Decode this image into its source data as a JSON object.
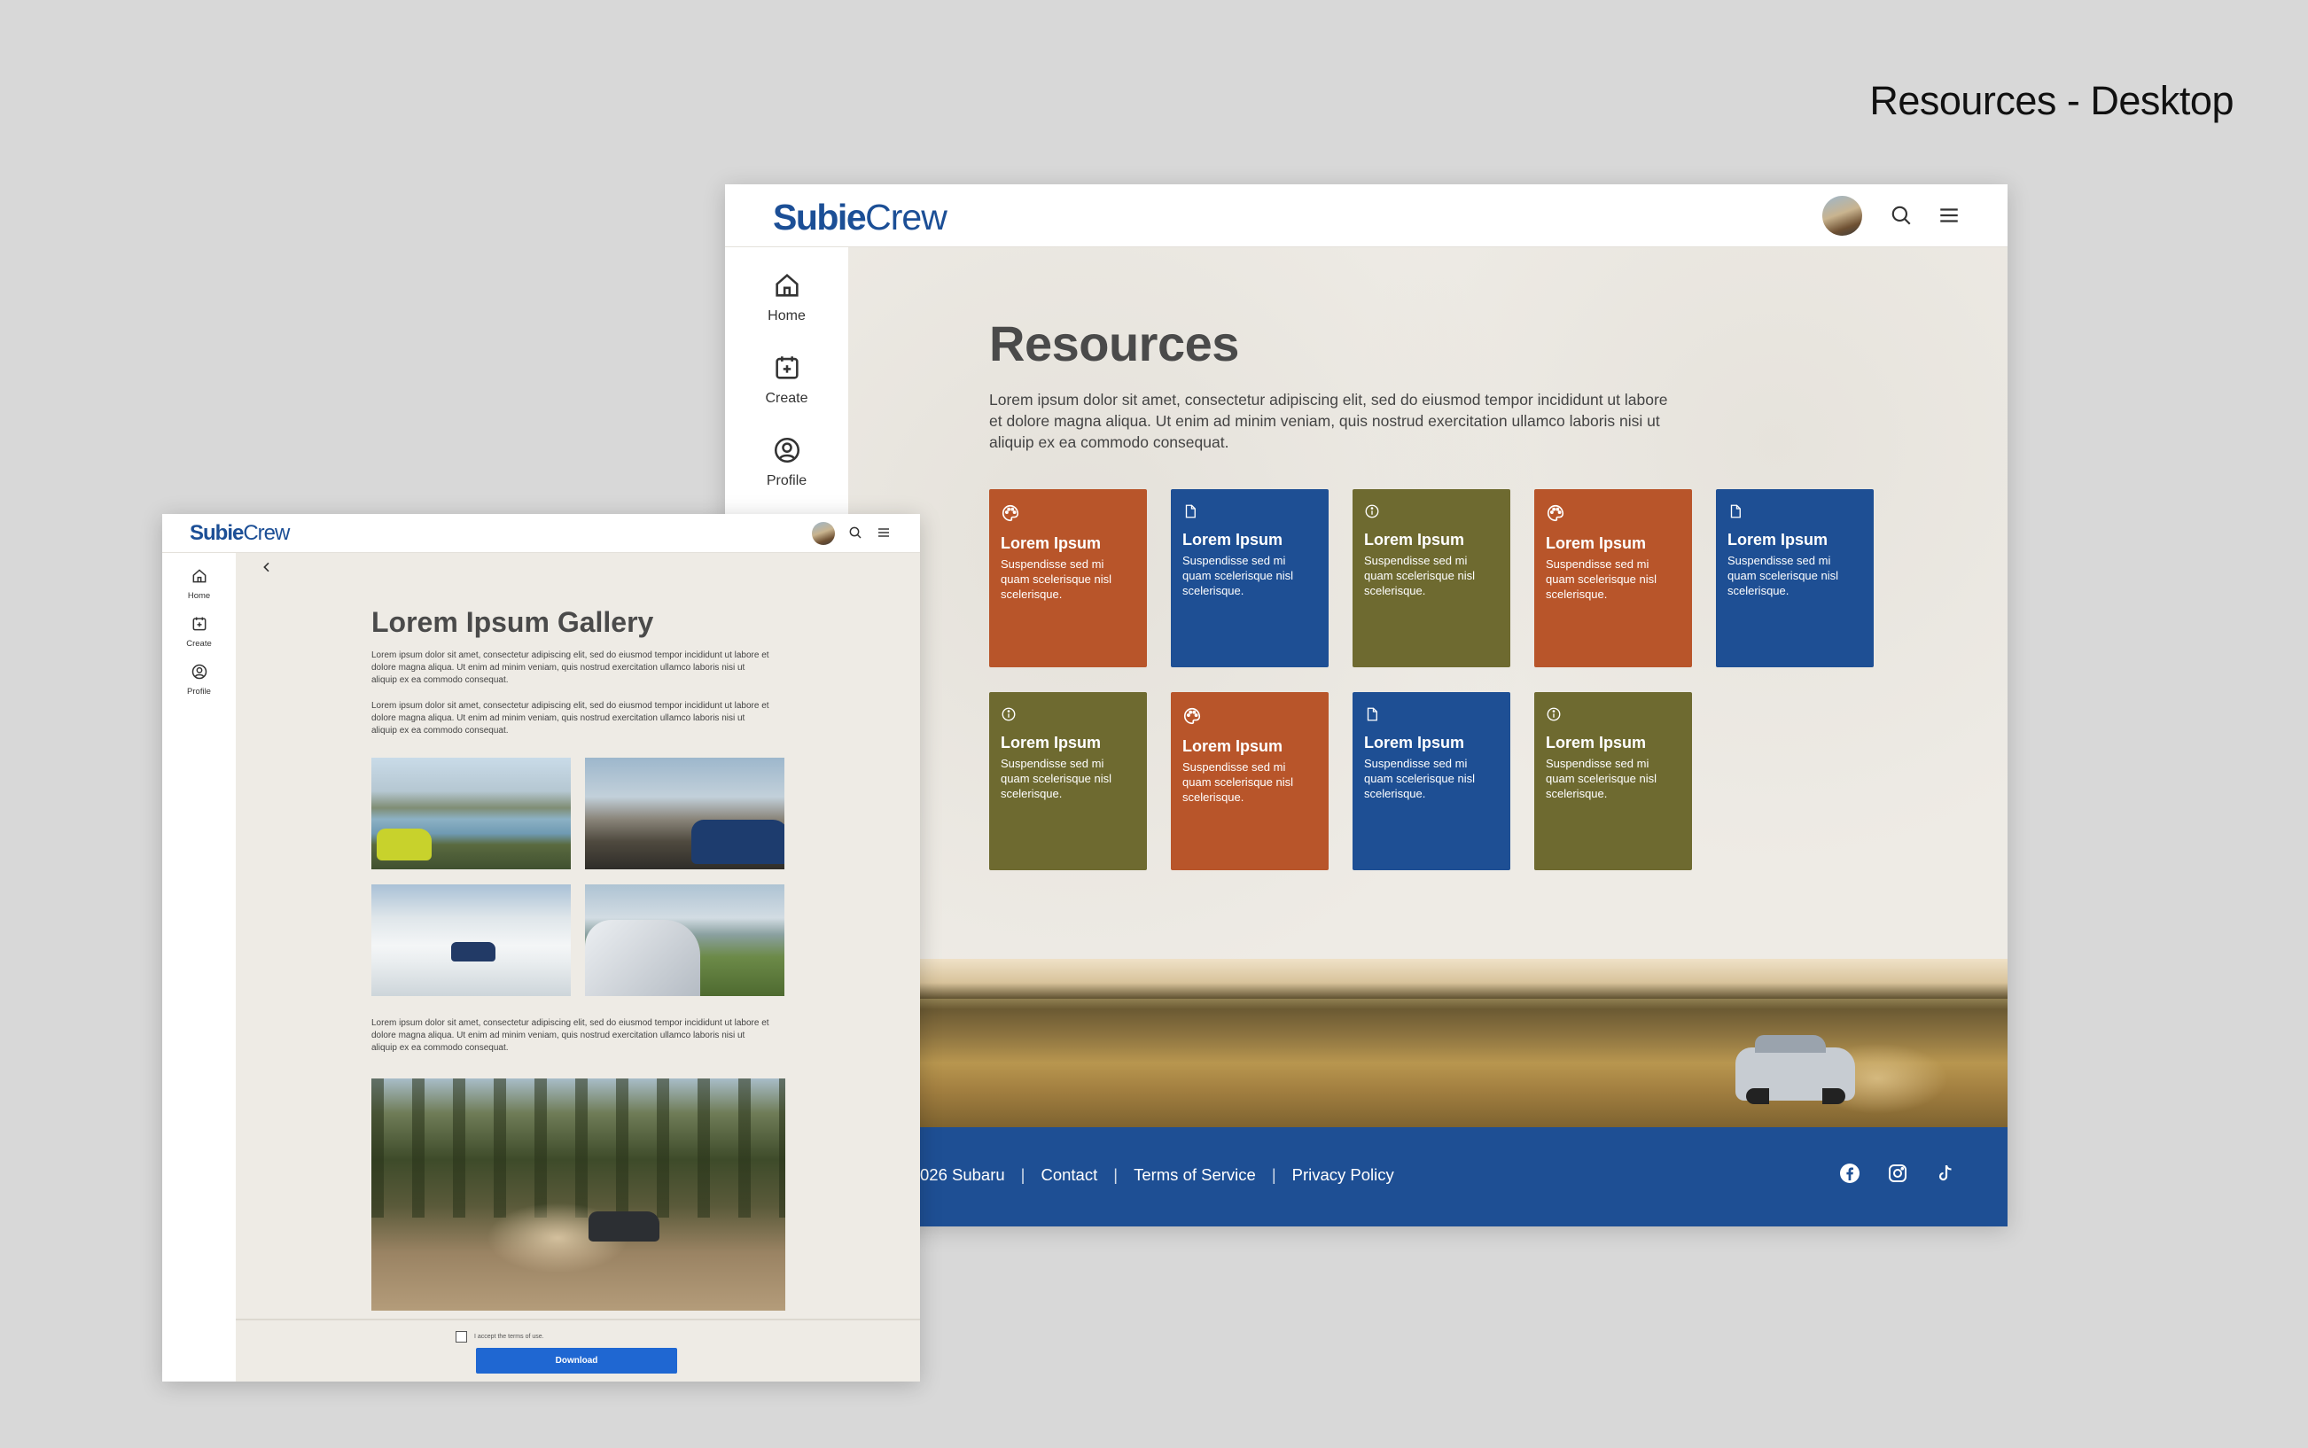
{
  "page_label": "Resources - Desktop",
  "brand": {
    "logo_bold": "Subie",
    "logo_light": "Crew"
  },
  "nav": {
    "home": "Home",
    "create": "Create",
    "profile": "Profile"
  },
  "desktop": {
    "title": "Resources",
    "intro": "Lorem ipsum dolor sit amet, consectetur adipiscing elit, sed do eiusmod tempor incididunt ut labore et dolore magna aliqua. Ut enim ad minim veniam, quis nostrud exercitation ullamco laboris nisi ut aliquip ex ea commodo consequat.",
    "cards": [
      {
        "title": "Lorem Ipsum",
        "body": "Suspendisse sed mi quam scelerisque nisl scelerisque.",
        "icon": "palette-icon",
        "color": "#b8552a"
      },
      {
        "title": "Lorem Ipsum",
        "body": "Suspendisse sed mi quam scelerisque nisl scelerisque.",
        "icon": "document-icon",
        "color": "#1e4f94"
      },
      {
        "title": "Lorem Ipsum",
        "body": "Suspendisse sed mi quam scelerisque nisl scelerisque.",
        "icon": "info-icon",
        "color": "#6e6a30"
      },
      {
        "title": "Lorem Ipsum",
        "body": "Suspendisse sed mi quam scelerisque nisl scelerisque.",
        "icon": "palette-icon",
        "color": "#b8552a"
      },
      {
        "title": "Lorem Ipsum",
        "body": "Suspendisse sed mi quam scelerisque nisl scelerisque.",
        "icon": "document-icon",
        "color": "#1e4f94"
      },
      {
        "title": "Lorem Ipsum",
        "body": "Suspendisse sed mi quam scelerisque nisl scelerisque.",
        "icon": "info-icon",
        "color": "#6e6a30"
      },
      {
        "title": "Lorem Ipsum",
        "body": "Suspendisse sed mi quam scelerisque nisl scelerisque.",
        "icon": "palette-icon",
        "color": "#b8552a"
      },
      {
        "title": "Lorem Ipsum",
        "body": "Suspendisse sed mi quam scelerisque nisl scelerisque.",
        "icon": "document-icon",
        "color": "#1e4f94"
      },
      {
        "title": "Lorem Ipsum",
        "body": "Suspendisse sed mi quam scelerisque nisl scelerisque.",
        "icon": "info-icon",
        "color": "#6e6a30"
      }
    ],
    "footer": {
      "copyright": "026 Subaru",
      "contact": "Contact",
      "terms": "Terms of Service",
      "privacy": "Privacy Policy",
      "separator": "|"
    }
  },
  "gallery": {
    "title": "Lorem Ipsum Gallery",
    "para1": "Lorem ipsum dolor sit amet, consectetur adipiscing elit, sed do eiusmod tempor incididunt ut labore et dolore magna aliqua. Ut enim ad minim veniam, quis nostrud exercitation ullamco laboris nisi ut aliquip ex ea commodo consequat.",
    "para2": "Lorem ipsum dolor sit amet, consectetur adipiscing elit, sed do eiusmod tempor incididunt ut labore et dolore magna aliqua. Ut enim ad minim veniam, quis nostrud exercitation ullamco laboris nisi ut aliquip ex ea commodo consequat.",
    "para3": "Lorem ipsum dolor sit amet, consectetur adipiscing elit, sed do eiusmod tempor incididunt ut labore et dolore magna aliqua. Ut enim ad minim veniam, quis nostrud exercitation ullamco laboris nisi ut aliquip ex ea commodo consequat.",
    "terms_label": "I accept the terms of use.",
    "download_label": "Download"
  },
  "colors": {
    "brand_blue": "#1e4f94",
    "orange": "#b8552a",
    "olive": "#6e6a30",
    "button_blue": "#1f67d2",
    "page_bg": "#eeebe5"
  }
}
